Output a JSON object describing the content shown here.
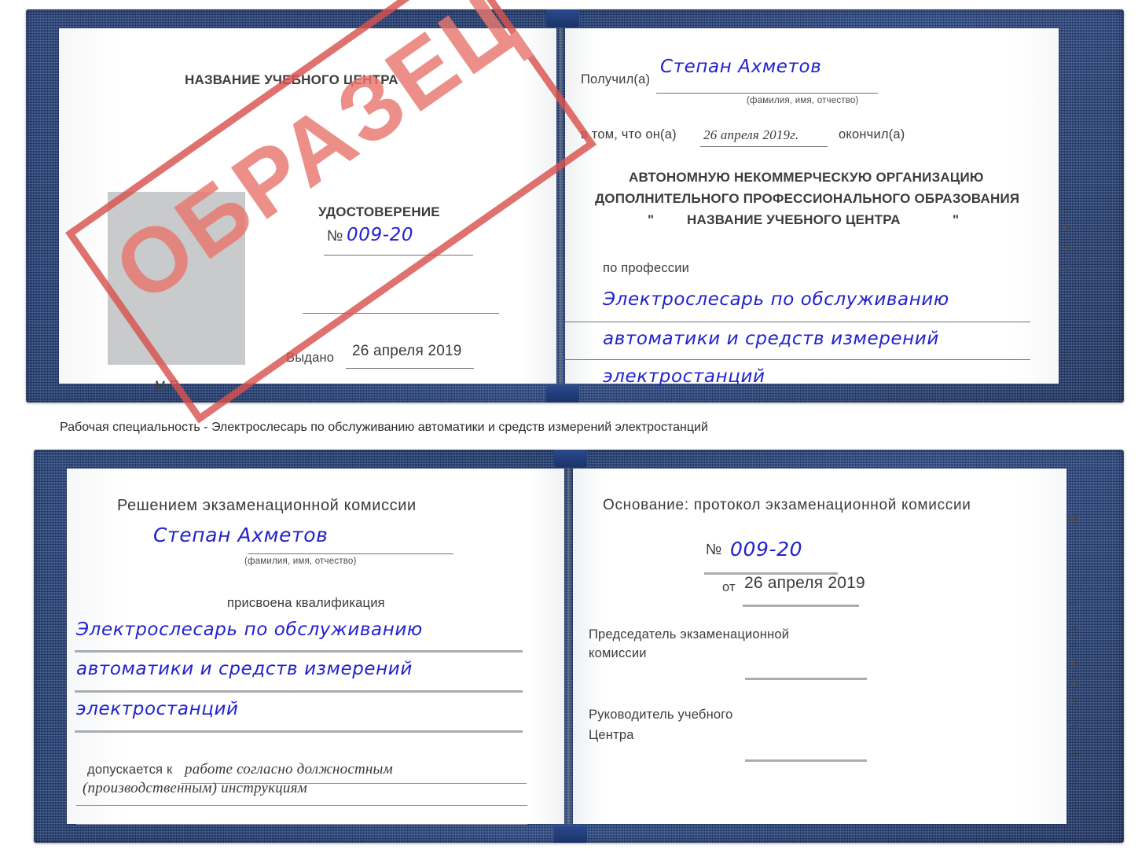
{
  "document": {
    "type": "certificate-scan",
    "stamp_text": "ОБРАЗЕЦ",
    "colors": {
      "cover_blue": "#23417f",
      "stamp_red": "#d9534f",
      "handwriting_blue": "#2222cc",
      "photo_placeholder_grey": "#c8cacb",
      "rule_grey": "#8d9095"
    }
  },
  "caption": {
    "text": "Рабочая специальность - Электрослесарь по обслуживанию автоматики и средств измерений электростанций"
  },
  "cert_top": {
    "left_page": {
      "center_name": "НАЗВАНИЕ УЧЕБНОГО ЦЕНТРА",
      "title": "УДОСТОВЕРЕНИЕ",
      "number_label": "№",
      "number_value": "009-20",
      "issued_label": "Выдано",
      "issued_value": "26 апреля 2019",
      "seal_label": "М.П.",
      "photo_placeholder": ""
    },
    "right_page": {
      "received_label": "Получил(а)",
      "received_value": "Степан Ахметов",
      "fio_hint": "(фамилия, имя, отчество)",
      "in_that_label": "в том, что он(а)",
      "completion_date": "26 апреля 2019г.",
      "finished_label": "окончил(а)",
      "org_line1": "АВТОНОМНУЮ НЕКОММЕРЧЕСКУЮ ОРГАНИЗАЦИЮ",
      "org_line2": "ДОПОЛНИТЕЛЬНОГО ПРОФЕССИОНАЛЬНОГО ОБРАЗОВАНИЯ",
      "org_quote_open": "\"",
      "org_line3": "НАЗВАНИЕ УЧЕБНОГО ЦЕНТРА",
      "org_quote_close": "\"",
      "profession_label": "по профессии",
      "profession_line1": "Электрослесарь по обслуживанию",
      "profession_line2": "автоматики и средств измерений",
      "profession_line3": "электростанций",
      "edge_fragments": [
        "–",
        "–",
        "–",
        "и",
        "а",
        "к-",
        "–",
        "–",
        "–"
      ]
    }
  },
  "cert_bottom": {
    "left_page": {
      "decision_title": "Решением экзаменационной комиссии",
      "name_value": "Степан Ахметов",
      "fio_hint": "(фамилия, имя, отчество)",
      "qualification_label": "присвоена квалификация",
      "qualification_line1": "Электрослесарь по обслуживанию",
      "qualification_line2": "автоматики и средств измерений",
      "qualification_line3": "электростанций",
      "admitted_label": "допускается к",
      "admitted_line1": "работе согласно должностным",
      "admitted_line2": "(производственным) инструкциям"
    },
    "right_page": {
      "basis_label": "Основание: протокол экзаменационной комиссии",
      "number_label": "№",
      "number_value": "009-20",
      "date_label": "от",
      "date_value": "26 апреля 2019",
      "chairman_line1": "Председатель экзаменационной",
      "chairman_line2": "комиссии",
      "head_line1": "Руководитель учебного",
      "head_line2": "Центра",
      "edge_fragments": [
        "ии",
        "–",
        "–",
        "–",
        "и",
        "а",
        "к-",
        "–",
        "–",
        "–",
        "–"
      ]
    }
  }
}
